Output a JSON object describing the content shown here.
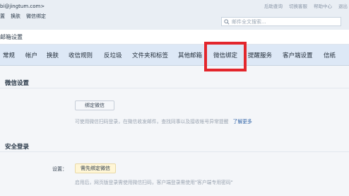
{
  "header": {
    "account": "bi@jingtum.com>",
    "links": [
      "置",
      "换肤",
      "微信绑定"
    ],
    "right_links": [
      "后助查询",
      "切换客服",
      "帮助中心",
      "退出"
    ],
    "search_placeholder": "邮件全文搜索..."
  },
  "page_title": "邮箱设置",
  "tabs": [
    {
      "label": "常规"
    },
    {
      "label": "帐户"
    },
    {
      "label": "换肤"
    },
    {
      "label": "收信规则"
    },
    {
      "label": "反垃圾"
    },
    {
      "label": "文件夹和标签"
    },
    {
      "label": "其他邮箱"
    },
    {
      "label": "微信绑定",
      "active": true
    },
    {
      "label": "提醒服务"
    },
    {
      "label": "客户端设置"
    },
    {
      "label": "信纸"
    }
  ],
  "wechat": {
    "section_title": "微信设置",
    "bind_button": "绑定微信",
    "hint": "可使用微信扫码登录，在微信收发邮件，查找同事以及接收帐号异常提醒",
    "more_link": "了解更多"
  },
  "security": {
    "section_title": "安全登录",
    "setting_label": "设置：",
    "bind_first_button": "需先绑定微信",
    "hint": "启用后，网页版登录需使用微信扫码，客户端登录需使用\"客户端专用密码\""
  },
  "colors": {
    "tab_bar": "#dde8f6",
    "highlight": "#e3262c",
    "link": "#2f63a7"
  }
}
